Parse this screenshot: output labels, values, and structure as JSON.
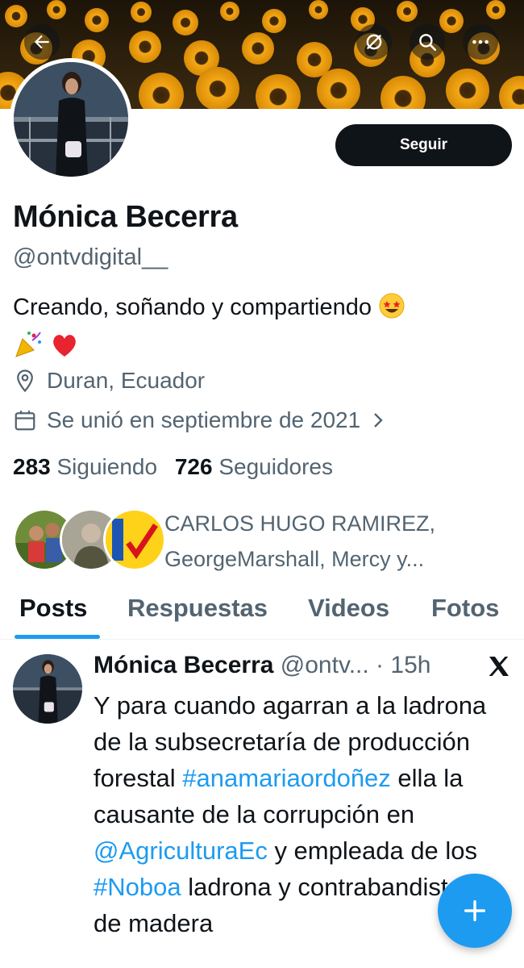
{
  "header": {
    "back_icon": "arrow-left-icon",
    "circle_icon": "circle-slash-icon",
    "search_icon": "search-icon",
    "more_icon": "more-dots-icon"
  },
  "profile": {
    "name": "Mónica Becerra",
    "handle": "@ontvdigital__",
    "follow_label": "Seguir",
    "bio_text": "Creando, soñando y compartiendo",
    "location": "Duran, Ecuador",
    "joined": "Se unió en septiembre de 2021",
    "following_count": "283",
    "following_label": "Siguiendo",
    "followers_count": "726",
    "followers_label": "Seguidores",
    "followed_by_text": "CARLOS HUGO RAMIREZ, GeorgeMarshall, Mercy y..."
  },
  "tabs": [
    "Posts",
    "Respuestas",
    "Videos",
    "Fotos"
  ],
  "tweet": {
    "name": "Mónica Becerra",
    "handle_time": "@ontv... · 15h",
    "text_1": "Y para cuando agarran a la ladrona de la subsecretaría de producción forestal",
    "hashtag_1": "#anamariaordoñez",
    "text_2": " ella la causante de la corrupción en ",
    "mention_1": "@AgriculturaEc",
    "text_3": " y empleada de los ",
    "hashtag_2": "#Noboa",
    "text_4": " ladrona y contrabandista de madera"
  },
  "colors": {
    "accent": "#1d9bf0",
    "text_primary": "#0f1419",
    "text_secondary": "#536471",
    "button_dark": "#0f1419"
  }
}
